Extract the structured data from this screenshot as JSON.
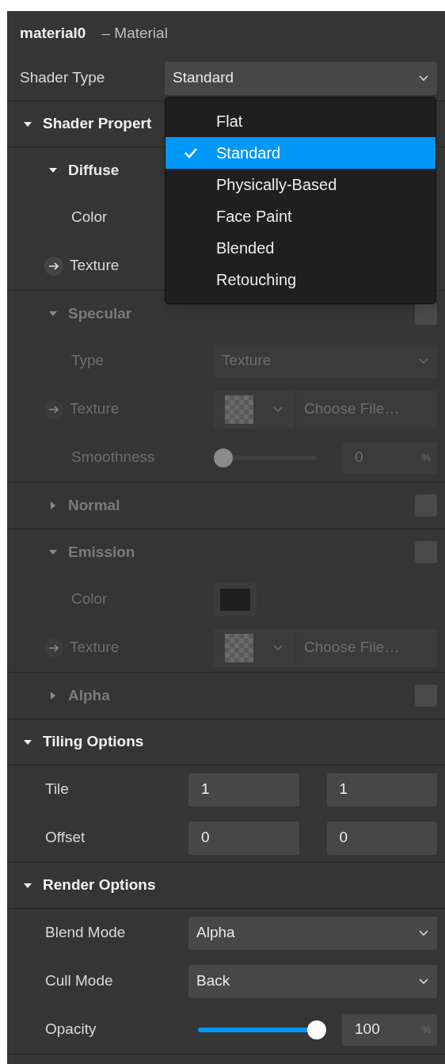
{
  "header": {
    "name": "material0",
    "type": "– Material"
  },
  "shader_type": {
    "label": "Shader Type",
    "value": "Standard"
  },
  "shader_menu": {
    "options": [
      {
        "label": "Flat",
        "selected": false
      },
      {
        "label": "Standard",
        "selected": true
      },
      {
        "label": "Physically-Based",
        "selected": false
      },
      {
        "label": "Face Paint",
        "selected": false
      },
      {
        "label": "Blended",
        "selected": false
      },
      {
        "label": "Retouching",
        "selected": false
      }
    ]
  },
  "sections": [
    {
      "title": "Shader Propert",
      "expanded": true,
      "groups": [
        {
          "title": "Diffuse",
          "expanded": true,
          "rows": [
            {
              "kind": "label",
              "label": "Color"
            },
            {
              "kind": "texture-label",
              "label": "Texture"
            }
          ]
        },
        {
          "title": "Specular",
          "expanded": true,
          "checked": false,
          "rows": [
            {
              "kind": "select",
              "label": "Type",
              "value": "Texture"
            },
            {
              "kind": "texture",
              "label": "Texture",
              "button": "Choose File…"
            },
            {
              "kind": "slider",
              "label": "Smoothness",
              "level": 0,
              "value": "0",
              "unit": "%"
            }
          ]
        },
        {
          "title": "Normal",
          "expanded": false,
          "checked": false
        },
        {
          "title": "Emission",
          "expanded": true,
          "checked": false,
          "rows": [
            {
              "kind": "color",
              "label": "Color"
            },
            {
              "kind": "texture",
              "label": "Texture",
              "button": "Choose File…"
            }
          ]
        },
        {
          "title": "Alpha",
          "expanded": false,
          "checked": false
        }
      ]
    },
    {
      "title": "Tiling Options",
      "expanded": true,
      "rows": [
        {
          "kind": "pair",
          "label": "Tile",
          "values": [
            "1",
            "1"
          ]
        },
        {
          "kind": "pair",
          "label": "Offset",
          "values": [
            "0",
            "0"
          ]
        }
      ]
    },
    {
      "title": "Render Options",
      "expanded": true,
      "rows": [
        {
          "kind": "select",
          "label": "Blend Mode",
          "value": "Alpha"
        },
        {
          "kind": "select",
          "label": "Cull Mode",
          "value": "Back"
        },
        {
          "kind": "slider",
          "label": "Opacity",
          "level": 1,
          "value": "100",
          "unit": "%"
        }
      ]
    }
  ]
}
